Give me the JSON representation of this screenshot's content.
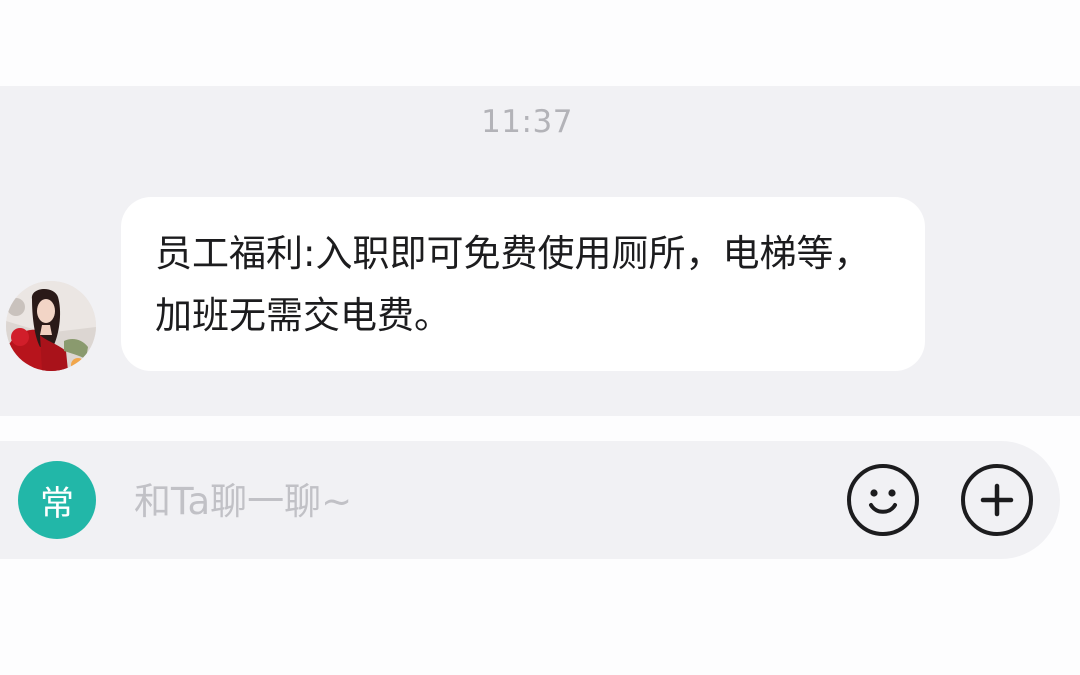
{
  "chat": {
    "timestamp": "11:37",
    "messages": [
      {
        "sender": "other",
        "text": "员工福利:入职即可免费使用厕所，电梯等，加班无需交电费。"
      }
    ]
  },
  "input_bar": {
    "tag_label": "常",
    "placeholder": "和Ta聊一聊~",
    "value": "",
    "emoji_icon": "smiley-face-icon",
    "plus_icon": "plus-circle-icon"
  },
  "colors": {
    "chat_background": "#f1f1f4",
    "bubble": "#ffffff",
    "tag_badge": "#22b7a8",
    "timestamp_text": "#b3b3b8",
    "placeholder_text": "#c1c1c6"
  }
}
